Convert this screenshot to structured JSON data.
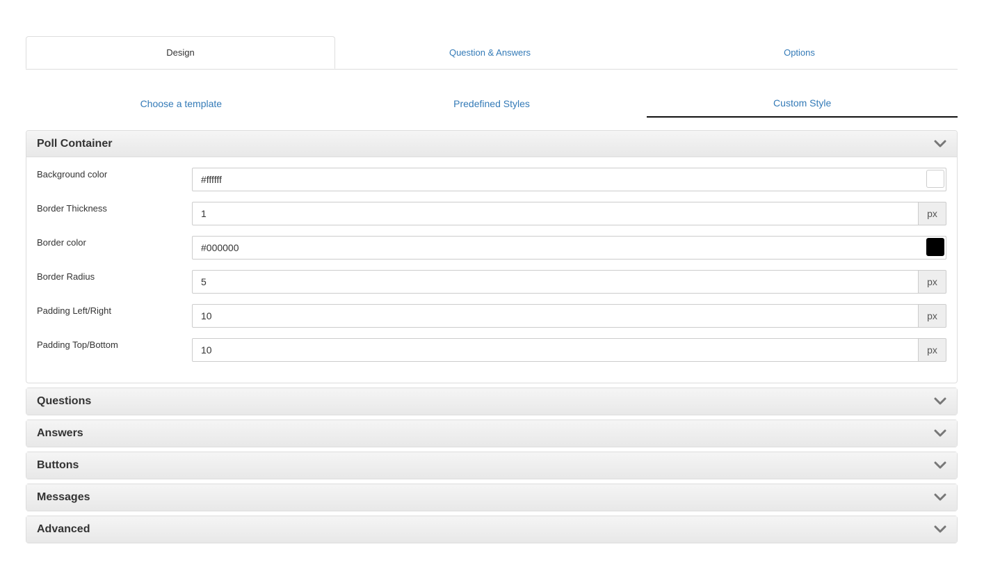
{
  "main_tabs": [
    {
      "label": "Design",
      "active": true
    },
    {
      "label": "Question & Answers",
      "active": false
    },
    {
      "label": "Options",
      "active": false
    }
  ],
  "sub_tabs": [
    {
      "label": "Choose a template",
      "active": false
    },
    {
      "label": "Predefined Styles",
      "active": false
    },
    {
      "label": "Custom Style",
      "active": true
    }
  ],
  "poll_container": {
    "title": "Poll Container",
    "icon": "chevron-down-icon",
    "fields": {
      "background_color": {
        "label": "Background color",
        "value": "#ffffff",
        "swatch": "#ffffff"
      },
      "border_thickness": {
        "label": "Border Thickness",
        "value": "1",
        "unit": "px"
      },
      "border_color": {
        "label": "Border color",
        "value": "#000000",
        "swatch": "#000000"
      },
      "border_radius": {
        "label": "Border Radius",
        "value": "5",
        "unit": "px"
      },
      "padding_lr": {
        "label": "Padding Left/Right",
        "value": "10",
        "unit": "px"
      },
      "padding_tb": {
        "label": "Padding Top/Bottom",
        "value": "10",
        "unit": "px"
      }
    }
  },
  "collapsed_sections": [
    {
      "title": "Questions"
    },
    {
      "title": "Answers"
    },
    {
      "title": "Buttons"
    },
    {
      "title": "Messages"
    },
    {
      "title": "Advanced"
    }
  ],
  "colors": {
    "link": "#337ab7",
    "active_underline": "#111111",
    "border": "#dddddd"
  }
}
